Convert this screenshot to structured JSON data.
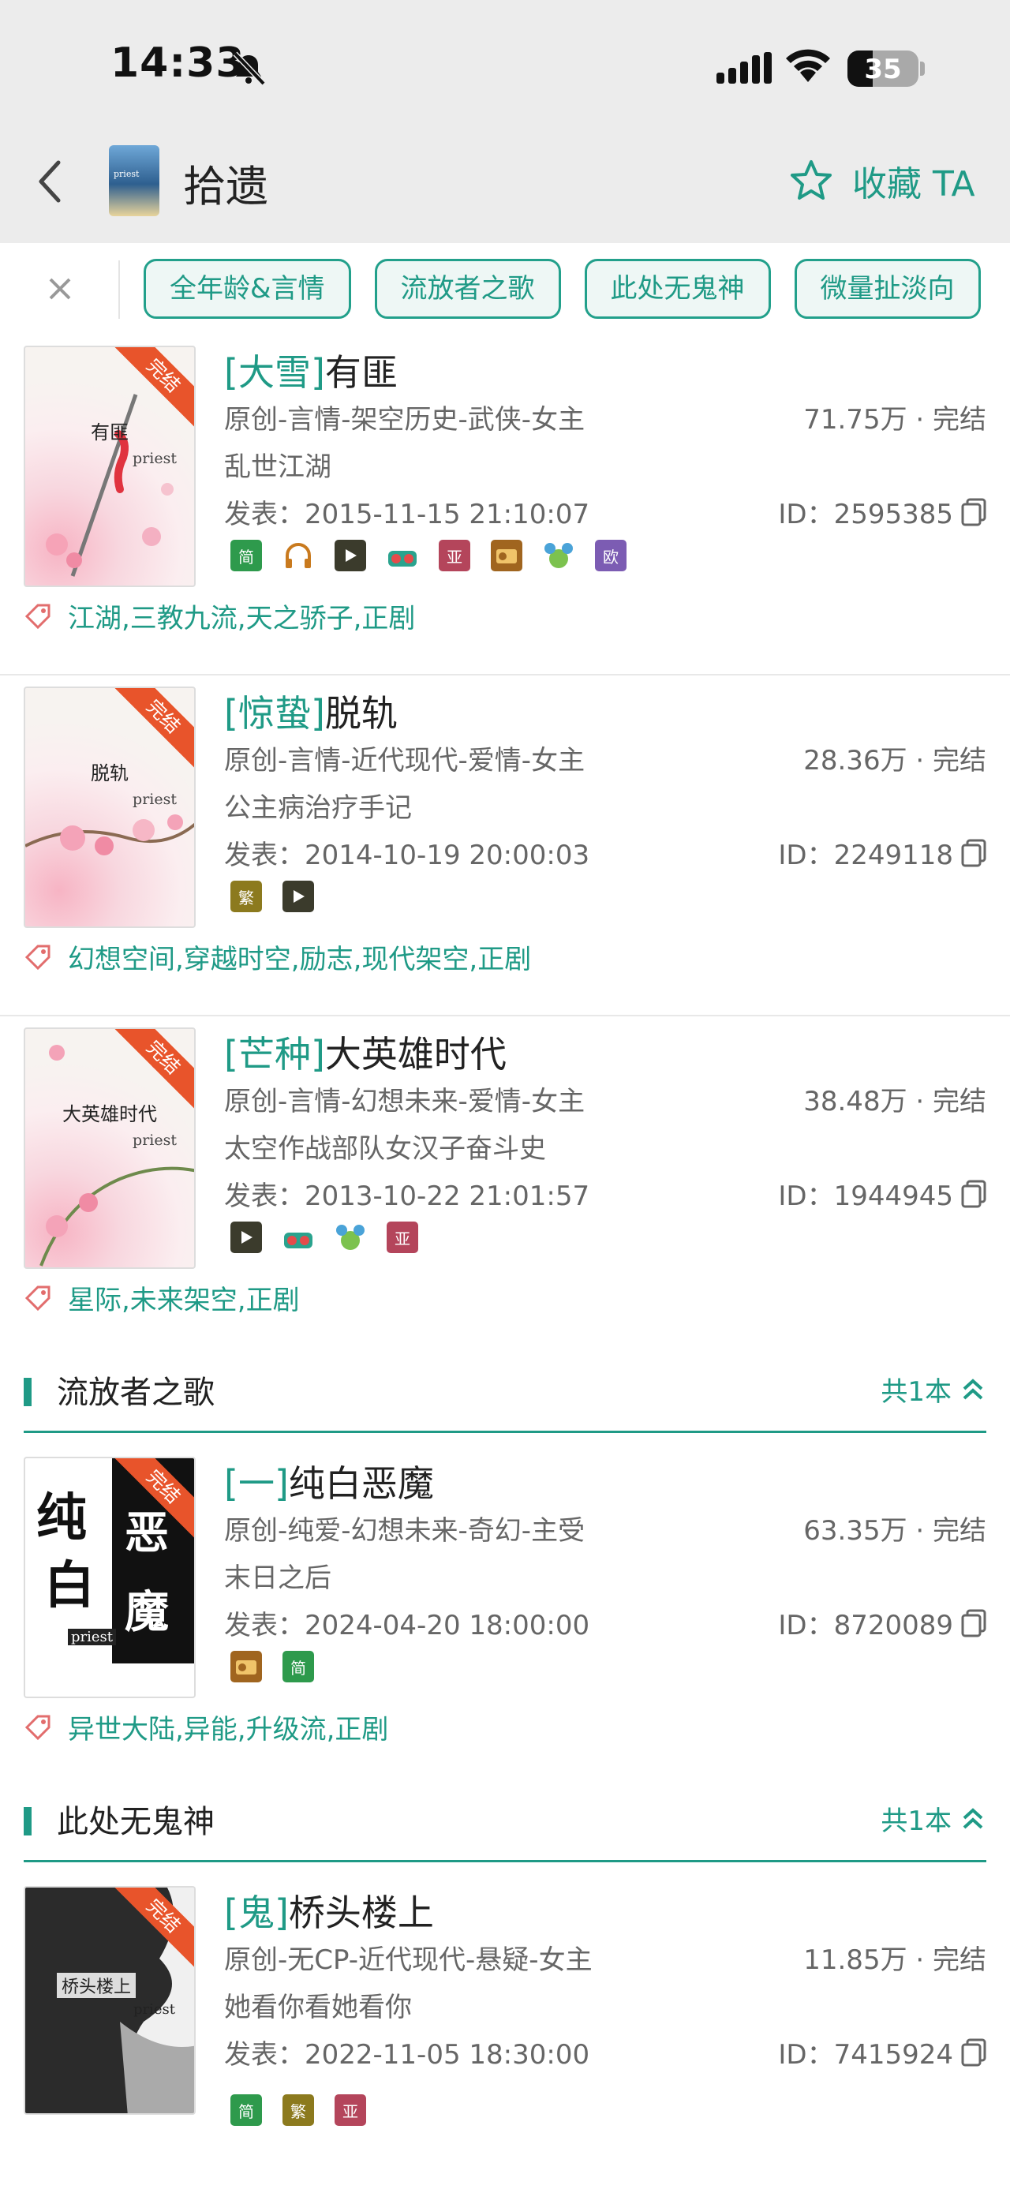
{
  "status": {
    "time": "14:33",
    "battery": "35",
    "battery_level": 0.35
  },
  "nav": {
    "title": "拾遗",
    "avatar_text": "priest",
    "fav_label": "收藏 TA"
  },
  "filters": [
    "全年龄&言情",
    "流放者之歌",
    "此处无鬼神",
    "微量扯淡向"
  ],
  "books": [
    {
      "cover_title": "有匪",
      "cover_author": "priest",
      "ribbon": "完结",
      "prefix": "[大雪]",
      "name": "有匪",
      "meta": "原创-言情-架空历史-武侠-女主",
      "stat": "71.75万 · 完结",
      "desc": "乱世江湖",
      "date": "发表：2015-11-15 21:10:07",
      "id": "ID：2595385",
      "tags": "江湖,三教九流,天之骄子,正剧"
    },
    {
      "cover_title": "脱轨",
      "cover_author": "priest",
      "ribbon": "完结",
      "prefix": "[惊蛰]",
      "name": "脱轨",
      "meta": "原创-言情-近代现代-爱情-女主",
      "stat": "28.36万 · 完结",
      "desc": "公主病治疗手记",
      "date": "发表：2014-10-19 20:00:03",
      "id": "ID：2249118",
      "tags": "幻想空间,穿越时空,励志,现代架空,正剧"
    },
    {
      "cover_title": "大英雄时代",
      "cover_author": "priest",
      "ribbon": "完结",
      "prefix": "[芒种]",
      "name": "大英雄时代",
      "meta": "原创-言情-幻想未来-爱情-女主",
      "stat": "38.48万 · 完结",
      "desc": "太空作战部队女汉子奋斗史",
      "date": "发表：2013-10-22 21:01:57",
      "id": "ID：1944945",
      "tags": "星际,未来架空,正剧"
    },
    {
      "cover_title": "纯白恶魔",
      "cover_author": "priest",
      "ribbon": "完结",
      "prefix": "[一]",
      "name": "纯白恶魔",
      "meta": "原创-纯爱-幻想未来-奇幻-主受",
      "stat": "63.35万 · 完结",
      "desc": "末日之后",
      "date": "发表：2024-04-20 18:00:00",
      "id": "ID：8720089",
      "tags": "异世大陆,异能,升级流,正剧"
    },
    {
      "cover_title": "桥头楼上",
      "cover_author": "priest",
      "ribbon": "完结",
      "prefix": "[鬼]",
      "name": "桥头楼上",
      "meta": "原创-无CP-近代现代-悬疑-女主",
      "stat": "11.85万 · 完结",
      "desc": "她看你看她看你",
      "date": "发表：2022-11-05 18:30:00",
      "id": "ID：7415924",
      "tags": ""
    }
  ],
  "sections": [
    {
      "title": "流放者之歌",
      "count": "共1本"
    },
    {
      "title": "此处无鬼神",
      "count": "共1本"
    }
  ],
  "icon_labels": {
    "jian": "简",
    "fan": "繁",
    "ya": "亚",
    "ou": "欧"
  },
  "colors": {
    "accent": "#1f9a86",
    "ribbon": "#e8542b"
  }
}
